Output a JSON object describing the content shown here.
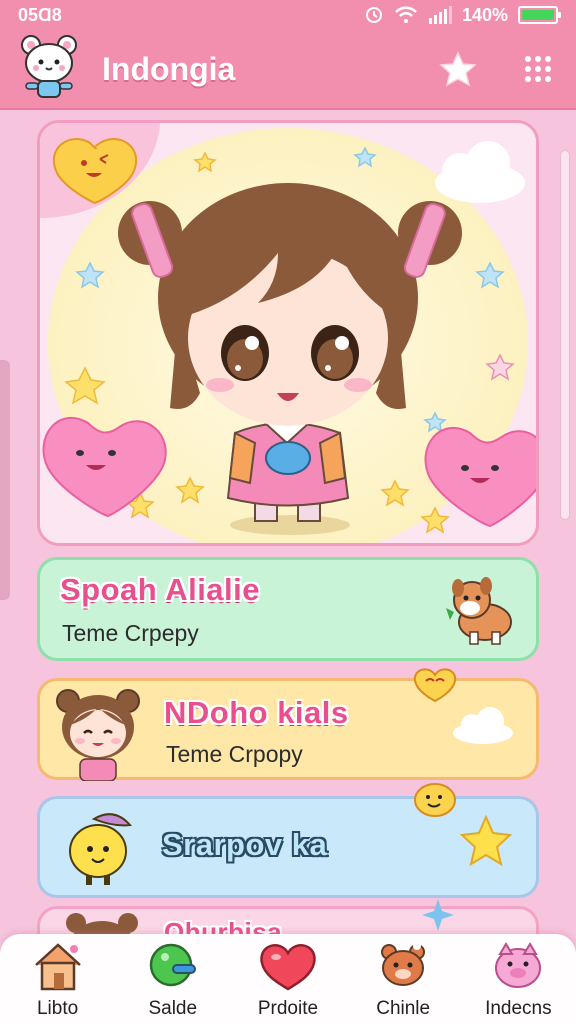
{
  "status_bar": {
    "time": "05Ɑ8",
    "battery": "140%",
    "battery_level": 1.0
  },
  "header": {
    "title": "Indongia",
    "favorite_icon": "star-icon",
    "menu_icon": "grid-icon"
  },
  "cards": [
    {
      "title": "Spoah Alialie",
      "subtitle": "Teme Crpepy",
      "art": "puppy-icon"
    },
    {
      "title": "NDoho kials",
      "subtitle": "Teme Crpopy",
      "art": "chibi-bear-girl-icon"
    },
    {
      "title": "Srarpov ka",
      "subtitle": "",
      "art": "lemon-hat-icon"
    },
    {
      "title": "Ohurbisa",
      "subtitle": "",
      "art": "bear-ears-icon"
    }
  ],
  "nav": [
    {
      "label": "Libto",
      "icon": "house-icon"
    },
    {
      "label": "Salde",
      "icon": "green-ball-icon"
    },
    {
      "label": "Prdoite",
      "icon": "heart-icon"
    },
    {
      "label": "Chinle",
      "icon": "bear-icon"
    },
    {
      "label": "Indecns",
      "icon": "pig-icon"
    }
  ],
  "colors": {
    "accent": "#f38fae",
    "background": "#f6c4dd",
    "green_card": "#c9f3d6",
    "yellow_card": "#ffe7a7",
    "blue_card": "#c9e8fa"
  }
}
